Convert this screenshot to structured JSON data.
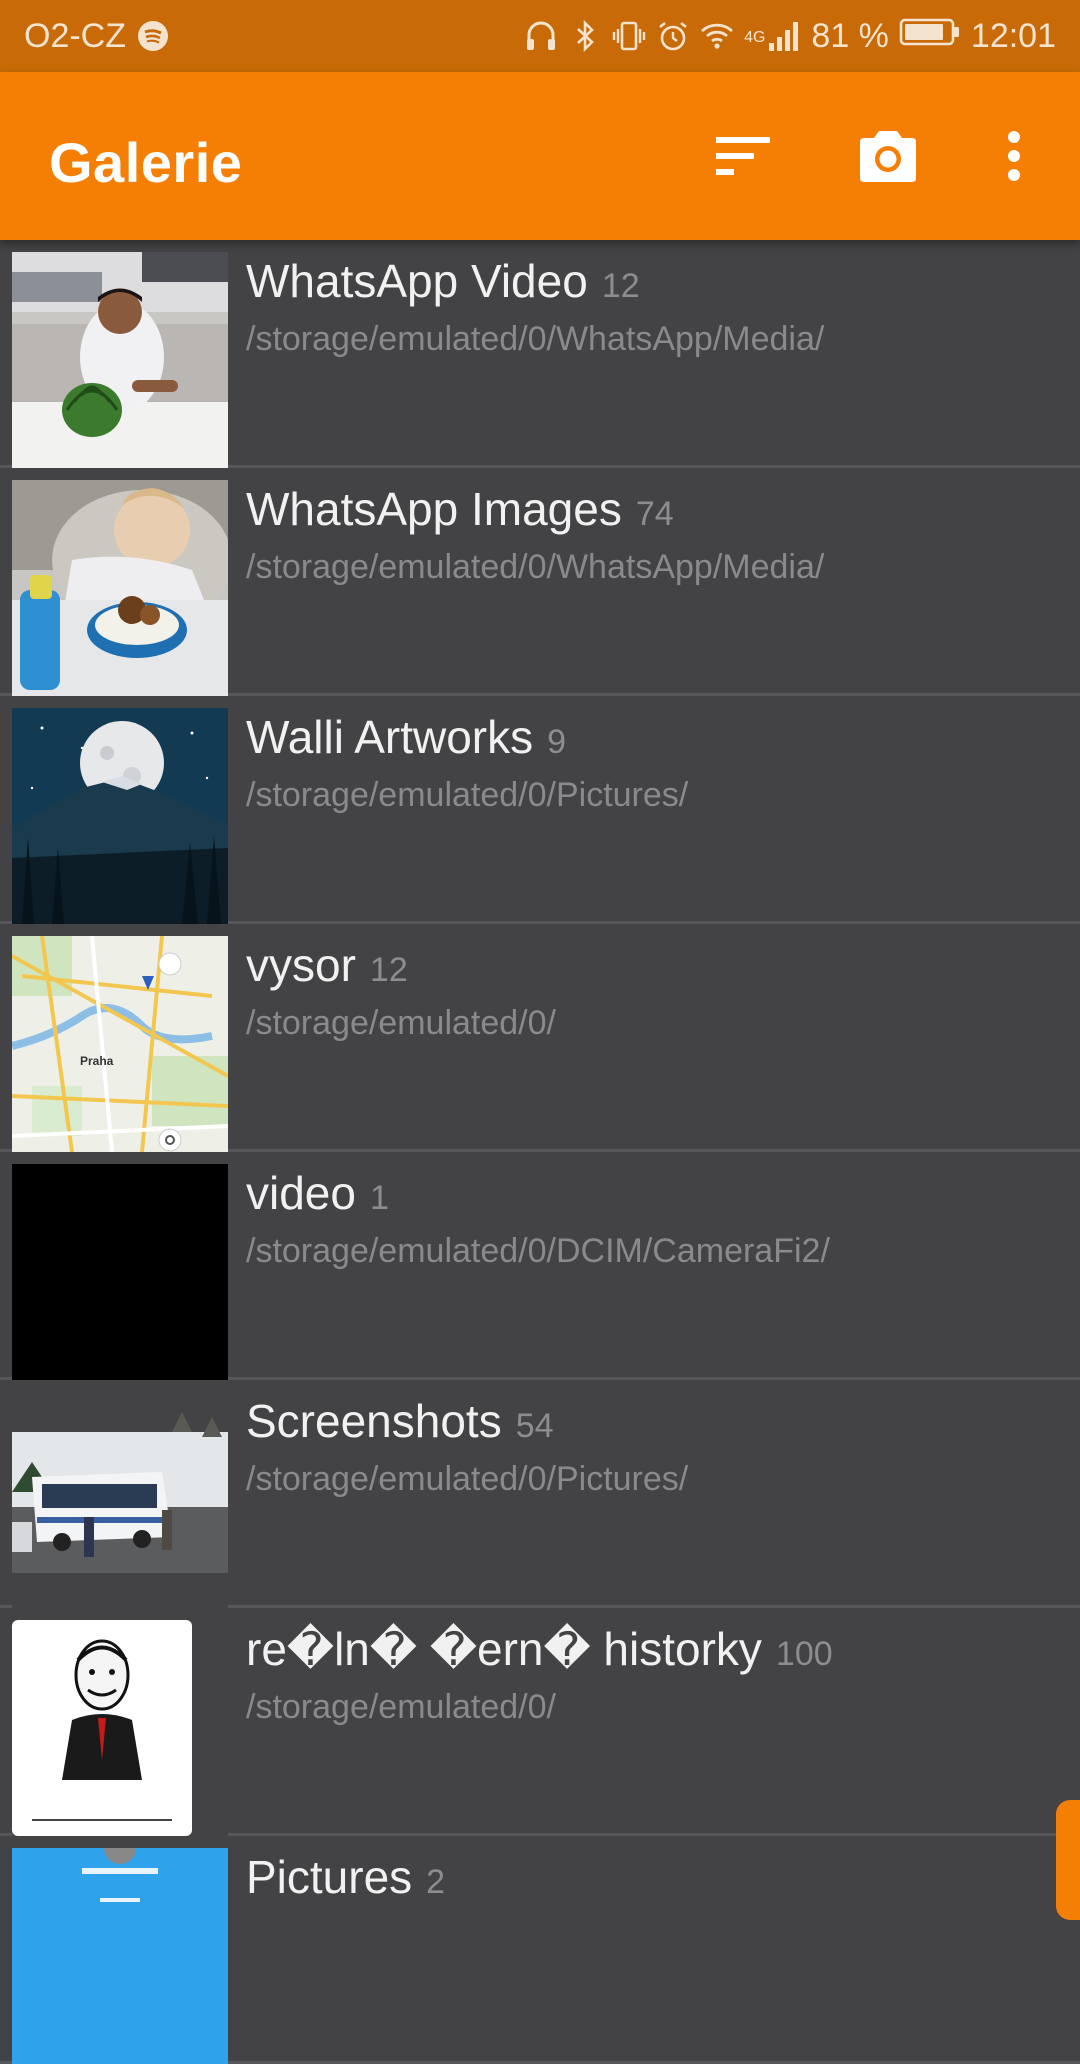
{
  "status_bar": {
    "carrier": "O2-CZ",
    "battery": "81 %",
    "time": "12:01",
    "network": "4G",
    "icons": [
      "spotify-icon",
      "headphones-icon",
      "bluetooth-icon",
      "vibrate-icon",
      "alarm-icon",
      "wifi-icon",
      "signal-icon",
      "battery-icon"
    ]
  },
  "app_bar": {
    "title": "Galerie",
    "actions": [
      "sort-icon",
      "camera-icon",
      "more-vert-icon"
    ],
    "color": "#f47f04"
  },
  "folders": [
    {
      "name": "WhatsApp Video",
      "count": "12",
      "path": "/storage/emulated/0/WhatsApp/Media/",
      "thumbnail": "watermelon-photo"
    },
    {
      "name": "WhatsApp Images",
      "count": "74",
      "path": "/storage/emulated/0/WhatsApp/Media/",
      "thumbnail": "child-eating-photo"
    },
    {
      "name": "Walli Artworks",
      "count": "9",
      "path": "/storage/emulated/0/Pictures/",
      "thumbnail": "moon-mountain-artwork"
    },
    {
      "name": "vysor",
      "count": "12",
      "path": "/storage/emulated/0/",
      "thumbnail": "map-screenshot",
      "map_label": "Praha"
    },
    {
      "name": "video",
      "count": "1",
      "path": "/storage/emulated/0/DCIM/CameraFi2/",
      "thumbnail": "black-frame"
    },
    {
      "name": "Screenshots",
      "count": "54",
      "path": "/storage/emulated/0/Pictures/",
      "thumbnail": "bus-photo"
    },
    {
      "name": "re�ln� �ern� historky",
      "count": "100",
      "path": "/storage/emulated/0/",
      "thumbnail": "cartoon-illustration"
    },
    {
      "name": "Pictures",
      "count": "2",
      "path": "",
      "thumbnail": "blue-app-screenshot"
    }
  ]
}
